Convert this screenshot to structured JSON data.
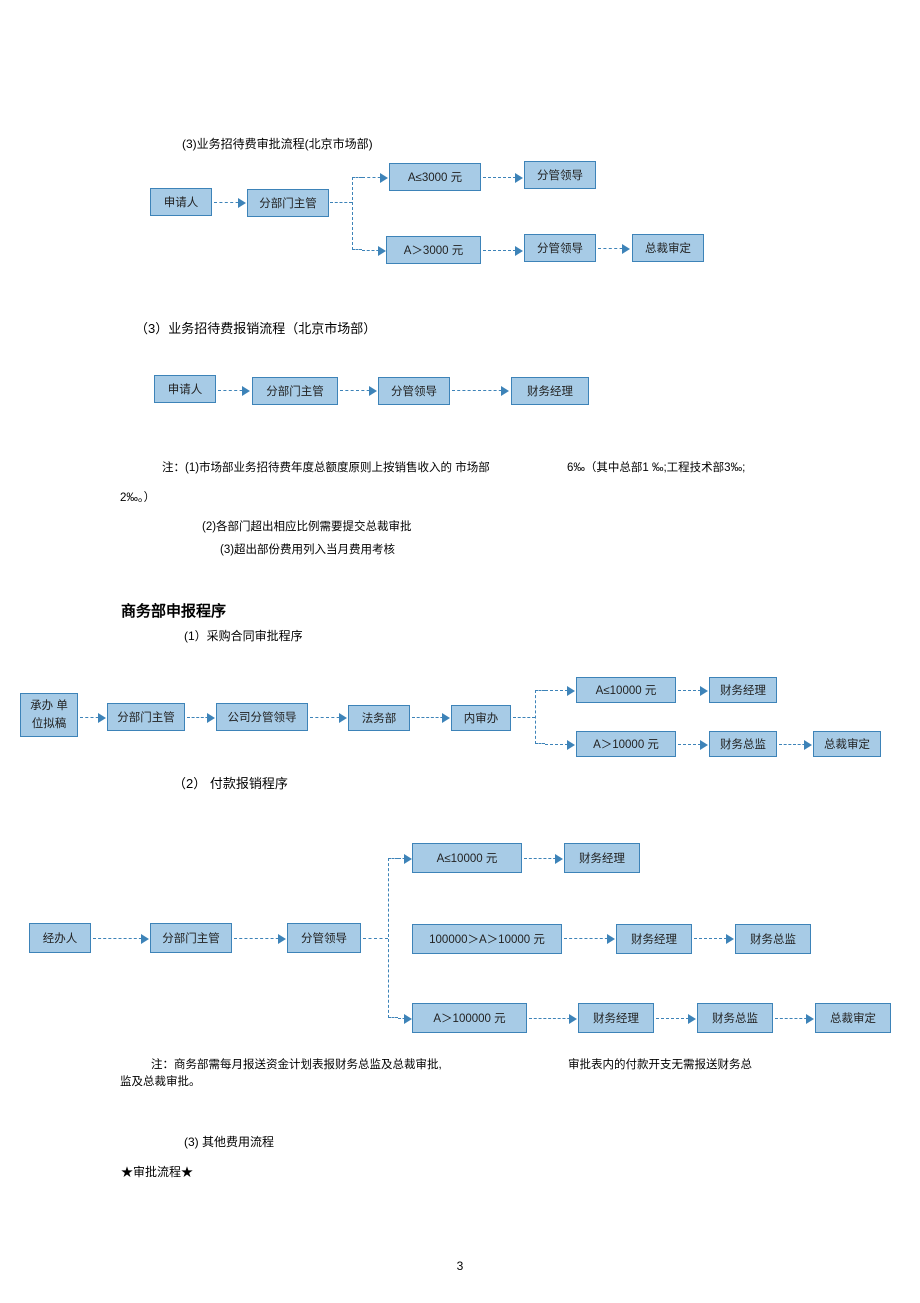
{
  "flow1": {
    "title": "(3)业务招待费审批流程(北京市场部)",
    "n1": "申请人",
    "n2": "分部门主管",
    "c1": "A≤3000 元",
    "c2": "A＞3000 元",
    "n3a": "分管领导",
    "n3b": "分管领导",
    "n4": "总裁审定"
  },
  "flow2": {
    "title": "（3）业务招待费报销流程（北京市场部）",
    "n1": "申请人",
    "n2": "分部门主管",
    "n3": "分管领导",
    "n4": "财务经理"
  },
  "notes1": {
    "l1a": "注：(1)市场部业务招待费年度总额度原则上按销售收入的 市场部",
    "l1b": "6‰（其中总部1 ‰;工程技术部3‰;",
    "l1c": "2‰。）",
    "l2": "(2)各部门超出相应比例需要提交总裁审批",
    "l3": "(3)超出部份费用列入当月费用考核"
  },
  "section2": {
    "title": "商务部申报程序",
    "sub1": "(1）采购合同审批程序"
  },
  "flow3": {
    "n1": "承办 单位拟稿",
    "n2": "分部门主管",
    "n3": "公司分管领导",
    "n4": "法务部",
    "n5": "内审办",
    "c1": "A≤10000 元",
    "c2": "A＞10000 元",
    "o1": "财务经理",
    "o2": "财务总监",
    "o3": "总裁审定"
  },
  "sub2": "（2）    付款报销程序",
  "flow4": {
    "n1": "经办人",
    "n2": "分部门主管",
    "n3": "分管领导",
    "c1": "A≤10000 元",
    "c2": "100000＞A＞10000 元",
    "c3": "A＞100000 元",
    "o_fm": "财务经理",
    "o_fd": "财务总监",
    "o_ceo": "总裁审定"
  },
  "notes2": {
    "l1a": "注：商务部需每月报送资金计划表报财务总监及总裁审批,",
    "l1b": "审批表内的付款开支无需报送财务总",
    "l2": "监及总裁审批。"
  },
  "sub3": "(3)   其他费用流程",
  "sub3b": "★审批流程★",
  "page_num": "3"
}
